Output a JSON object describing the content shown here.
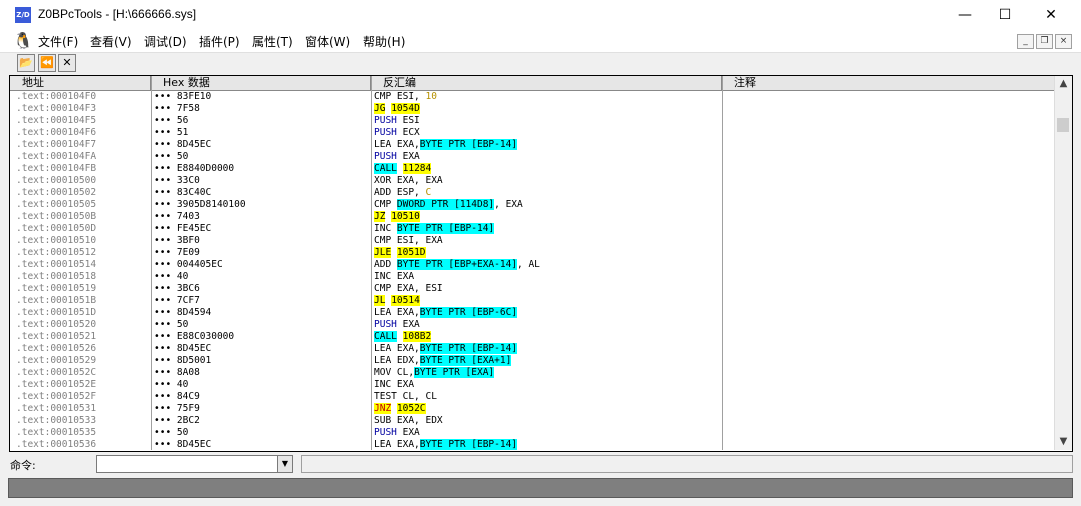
{
  "window": {
    "icon_text": "Z/D",
    "title": "Z0BPcTools - [H:\\666666.sys]",
    "min_glyph": "—",
    "max_glyph": "☐",
    "close_glyph": "✕"
  },
  "menu": {
    "items": [
      "文件(F)",
      "查看(V)",
      "调试(D)",
      "插件(P)",
      "属性(T)",
      "窗体(W)",
      "帮助(H)"
    ],
    "mdi_min": "_",
    "mdi_restore": "❐",
    "mdi_close": "×"
  },
  "toolbar": {
    "open_glyph": "📂",
    "back_glyph": "⏪",
    "close_glyph": "✕"
  },
  "columns": {
    "address": "地址",
    "hex": "Hex 数据",
    "disasm": "反汇编",
    "comment": "注释"
  },
  "rows": [
    {
      "addr": ".text:000104F0",
      "hex": "83FE10",
      "mn": "CMP",
      "mc": "",
      "ops": [
        {
          "t": " ESI,"
        },
        {
          "t": " 10",
          "s": "num"
        }
      ]
    },
    {
      "addr": ".text:000104F3",
      "hex": "7F58",
      "mn": "JG",
      "mc": "jmp",
      "ops": [
        {
          "t": " "
        },
        {
          "t": "1054D",
          "s": "jmp"
        }
      ]
    },
    {
      "addr": ".text:000104F5",
      "hex": "56",
      "mn": "PUSH",
      "mc": "push",
      "ops": [
        {
          "t": " ESI"
        }
      ]
    },
    {
      "addr": ".text:000104F6",
      "hex": "51",
      "mn": "PUSH",
      "mc": "push",
      "ops": [
        {
          "t": " ECX"
        }
      ]
    },
    {
      "addr": ".text:000104F7",
      "hex": "8D45EC",
      "mn": "LEA",
      "mc": "",
      "ops": [
        {
          "t": " EXA,"
        },
        {
          "t": "BYTE PTR [EBP-14]",
          "s": "mem"
        }
      ]
    },
    {
      "addr": ".text:000104FA",
      "hex": "50",
      "mn": "PUSH",
      "mc": "push",
      "ops": [
        {
          "t": " EXA"
        }
      ]
    },
    {
      "addr": ".text:000104FB",
      "hex": "E8840D0000",
      "mn": "CALL",
      "mc": "call",
      "ops": [
        {
          "t": " "
        },
        {
          "t": "11284",
          "s": "jmp"
        }
      ]
    },
    {
      "addr": ".text:00010500",
      "hex": "33C0",
      "mn": "XOR",
      "mc": "",
      "ops": [
        {
          "t": " EXA, EXA"
        }
      ]
    },
    {
      "addr": ".text:00010502",
      "hex": "83C40C",
      "mn": "ADD",
      "mc": "",
      "ops": [
        {
          "t": " ESP,"
        },
        {
          "t": " C",
          "s": "num"
        }
      ]
    },
    {
      "addr": ".text:00010505",
      "hex": "3905D8140100",
      "mn": "CMP",
      "mc": "",
      "ops": [
        {
          "t": " "
        },
        {
          "t": "DWORD PTR [114D8]",
          "s": "mem"
        },
        {
          "t": ", EXA"
        }
      ]
    },
    {
      "addr": ".text:0001050B",
      "hex": "7403",
      "mn": "JZ",
      "mc": "jmp",
      "ops": [
        {
          "t": " "
        },
        {
          "t": "10510",
          "s": "jmp"
        }
      ]
    },
    {
      "addr": ".text:0001050D",
      "hex": "FE45EC",
      "mn": "INC",
      "mc": "",
      "ops": [
        {
          "t": " "
        },
        {
          "t": "BYTE PTR [EBP-14]",
          "s": "mem"
        }
      ]
    },
    {
      "addr": ".text:00010510",
      "hex": "3BF0",
      "mn": "CMP",
      "mc": "",
      "ops": [
        {
          "t": " ESI, EXA"
        }
      ]
    },
    {
      "addr": ".text:00010512",
      "hex": "7E09",
      "mn": "JLE",
      "mc": "jmp",
      "ops": [
        {
          "t": " "
        },
        {
          "t": "1051D",
          "s": "jmp"
        }
      ]
    },
    {
      "addr": ".text:00010514",
      "hex": "004405EC",
      "mn": "ADD",
      "mc": "",
      "ops": [
        {
          "t": " "
        },
        {
          "t": "BYTE PTR [EBP+EXA-14]",
          "s": "mem"
        },
        {
          "t": ", AL"
        }
      ]
    },
    {
      "addr": ".text:00010518",
      "hex": "40",
      "mn": "INC",
      "mc": "",
      "ops": [
        {
          "t": " EXA"
        }
      ]
    },
    {
      "addr": ".text:00010519",
      "hex": "3BC6",
      "mn": "CMP",
      "mc": "",
      "ops": [
        {
          "t": " EXA, ESI"
        }
      ]
    },
    {
      "addr": ".text:0001051B",
      "hex": "7CF7",
      "mn": "JL",
      "mc": "jmp",
      "ops": [
        {
          "t": " "
        },
        {
          "t": "10514",
          "s": "jmp"
        }
      ]
    },
    {
      "addr": ".text:0001051D",
      "hex": "8D4594",
      "mn": "LEA",
      "mc": "",
      "ops": [
        {
          "t": " EXA,"
        },
        {
          "t": "BYTE PTR [EBP-6C]",
          "s": "mem"
        }
      ]
    },
    {
      "addr": ".text:00010520",
      "hex": "50",
      "mn": "PUSH",
      "mc": "push",
      "ops": [
        {
          "t": " EXA"
        }
      ]
    },
    {
      "addr": ".text:00010521",
      "hex": "E88C030000",
      "mn": "CALL",
      "mc": "call",
      "ops": [
        {
          "t": " "
        },
        {
          "t": "108B2",
          "s": "jmp"
        }
      ]
    },
    {
      "addr": ".text:00010526",
      "hex": "8D45EC",
      "mn": "LEA",
      "mc": "",
      "ops": [
        {
          "t": " EXA,"
        },
        {
          "t": "BYTE PTR [EBP-14]",
          "s": "mem"
        }
      ]
    },
    {
      "addr": ".text:00010529",
      "hex": "8D5001",
      "mn": "LEA",
      "mc": "",
      "ops": [
        {
          "t": " EDX,"
        },
        {
          "t": "BYTE PTR [EXA+1]",
          "s": "mem"
        }
      ]
    },
    {
      "addr": ".text:0001052C",
      "hex": "8A08",
      "mn": "MOV",
      "mc": "",
      "ops": [
        {
          "t": " CL,"
        },
        {
          "t": "BYTE PTR [EXA]",
          "s": "mem"
        }
      ]
    },
    {
      "addr": ".text:0001052E",
      "hex": "40",
      "mn": "INC",
      "mc": "",
      "ops": [
        {
          "t": " EXA"
        }
      ]
    },
    {
      "addr": ".text:0001052F",
      "hex": "84C9",
      "mn": "TEST",
      "mc": "",
      "ops": [
        {
          "t": " CL, CL"
        }
      ]
    },
    {
      "addr": ".text:00010531",
      "hex": "75F9",
      "mn": "JNZ",
      "mc": "jnz",
      "ops": [
        {
          "t": " "
        },
        {
          "t": "1052C",
          "s": "jmp"
        }
      ]
    },
    {
      "addr": ".text:00010533",
      "hex": "2BC2",
      "mn": "SUB",
      "mc": "",
      "ops": [
        {
          "t": " EXA, EDX"
        }
      ]
    },
    {
      "addr": ".text:00010535",
      "hex": "50",
      "mn": "PUSH",
      "mc": "push",
      "ops": [
        {
          "t": " EXA"
        }
      ]
    },
    {
      "addr": ".text:00010536",
      "hex": "8D45EC",
      "mn": "LEA",
      "mc": "",
      "ops": [
        {
          "t": " EXA,"
        },
        {
          "t": "BYTE PTR [EBP-14]",
          "s": "mem"
        }
      ]
    }
  ],
  "hex_prefix": "•••",
  "command": {
    "label": "命令:",
    "value": "",
    "arrow_glyph": "▼"
  },
  "scroll": {
    "up_glyph": "▲",
    "down_glyph": "▼"
  },
  "colors": {
    "jump_highlight": "#ffff00",
    "call_highlight": "#00ffff",
    "memory_operand": "#00ffff",
    "push_text": "#0000a0",
    "jnz_text": "#c00000",
    "status_bar": "#7f7f7f"
  }
}
